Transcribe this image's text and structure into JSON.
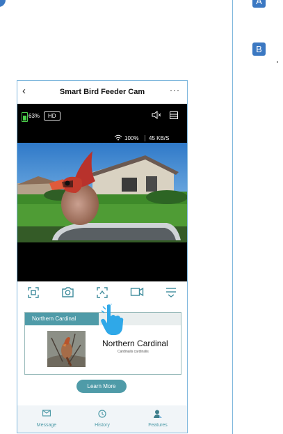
{
  "steps": {
    "a": "A",
    "b": "B"
  },
  "app": {
    "title": "Smart Bird Feeder Cam",
    "back_icon": "chevron-left-icon",
    "more_icon": "more-horizontal-icon"
  },
  "status": {
    "battery_level": "63%",
    "quality": "HD",
    "signal": "100%",
    "speed": "45 KB/S"
  },
  "controls": [
    {
      "icon": "screenshot-frame-icon"
    },
    {
      "icon": "camera-icon"
    },
    {
      "icon": "ai-identify-icon"
    },
    {
      "icon": "video-record-icon"
    },
    {
      "icon": "menu-lines-icon"
    }
  ],
  "card": {
    "header": "Northern Cardinal",
    "name": "Northern Cardinal",
    "subtitle": "Cardinalis cardinalis"
  },
  "learn_more": "Learn More",
  "tabs": [
    {
      "label": "Message",
      "icon": "envelope-icon"
    },
    {
      "label": "History",
      "icon": "clock-icon"
    },
    {
      "label": "Features",
      "icon": "person-icon"
    }
  ],
  "colors": {
    "accent": "#4f9ba8",
    "frame": "#7fb7dd",
    "badge": "#3b78c2",
    "battery": "#4bd04b"
  }
}
